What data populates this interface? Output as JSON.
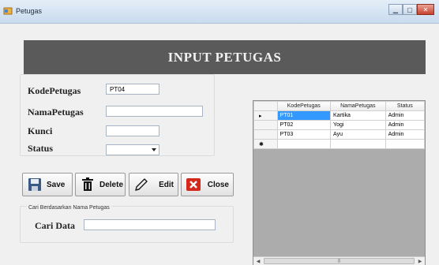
{
  "window": {
    "title": "Petugas",
    "colors": {
      "title_bar": "#c9dbee",
      "banner": "#5a5a5a",
      "selection": "#3399ff"
    }
  },
  "banner": {
    "title": "INPUT PETUGAS"
  },
  "form": {
    "kode_label": "KodePetugas",
    "kode_value": "PT04",
    "nama_label": "NamaPetugas",
    "nama_value": "",
    "kunci_label": "Kunci",
    "kunci_value": "",
    "status_label": "Status",
    "status_value": ""
  },
  "buttons": {
    "save": {
      "label": "Save",
      "icon": "floppy-disk-icon"
    },
    "delete": {
      "label": "Delete",
      "icon": "trash-icon"
    },
    "edit": {
      "label": "Edit",
      "icon": "pencil-icon"
    },
    "close": {
      "label": "Close",
      "icon": "close-icon"
    }
  },
  "search": {
    "group_caption": "Cari Berdasarkan Nama Petugas",
    "label": "Cari Data",
    "value": ""
  },
  "grid": {
    "columns": [
      "KodePetugas",
      "NamaPetugas",
      "Status"
    ],
    "rows": [
      [
        "PT01",
        "Kartika",
        "Admin"
      ],
      [
        "PT02",
        "Yogi",
        "Admin"
      ],
      [
        "PT03",
        "Ayu",
        "Admin"
      ]
    ],
    "selected_row": 0,
    "current_row_marker": "▸",
    "new_row_marker": "✱"
  }
}
